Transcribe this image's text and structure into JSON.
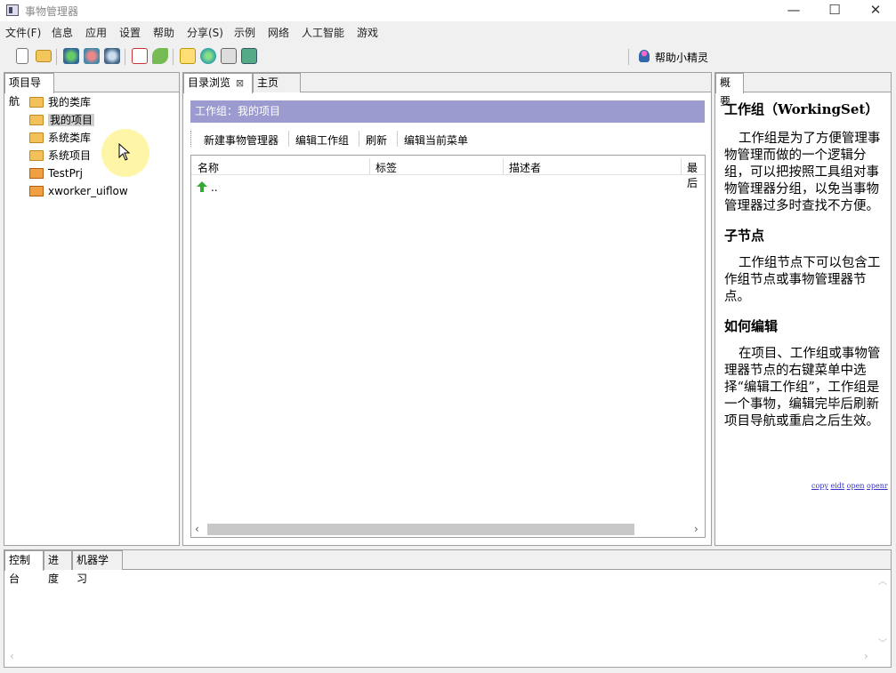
{
  "window": {
    "title": "事物管理器",
    "minimize": "—",
    "maximize": "☐",
    "close": "✕"
  },
  "menu": [
    "文件(F)",
    "信息",
    "应用",
    "设置",
    "帮助",
    "分享(S)",
    "示例",
    "网络",
    "人工智能",
    "游戏"
  ],
  "toolbar": {
    "helper_label": "帮助小精灵"
  },
  "nav": {
    "tab": "项目导航",
    "items": [
      "我的类库",
      "我的项目",
      "系统类库",
      "系统项目",
      "TestPrj",
      "xworker_uiflow"
    ],
    "selected_index": 1
  },
  "center": {
    "tabs": [
      "目录浏览",
      "主页"
    ],
    "tab_close": "⊠",
    "header": "工作组：我的项目",
    "actions": [
      "新建事物管理器",
      "编辑工作组",
      "刷新",
      "编辑当前菜单"
    ],
    "columns": [
      "名称",
      "标签",
      "描述者",
      "最后"
    ],
    "rows": [
      {
        "name": ".."
      }
    ]
  },
  "summary": {
    "tab": "概要",
    "title": "工作组（WorkingSet）",
    "p1": "工作组是为了方便管理事物管理而做的一个逻辑分组，可以把按照工具组对事物管理器分组，以免当事物管理器过多时查找不方便。",
    "h2": "子节点",
    "p2": "工作组节点下可以包含工作组节点或事物管理器节点。",
    "h3": "如何编辑",
    "p3": "在项目、工作组或事物管理器节点的右键菜单中选择“编辑工作组”，工作组是一个事物，编辑完毕后刷新项目导航或重启之后生效。",
    "links": [
      "copy",
      "eidt",
      "open",
      "openr"
    ]
  },
  "bottom": {
    "tabs": [
      "控制台",
      "进度",
      "机器学习"
    ]
  },
  "colors": {
    "header_bar": "#9b9bd0",
    "link": "#3333cc"
  }
}
